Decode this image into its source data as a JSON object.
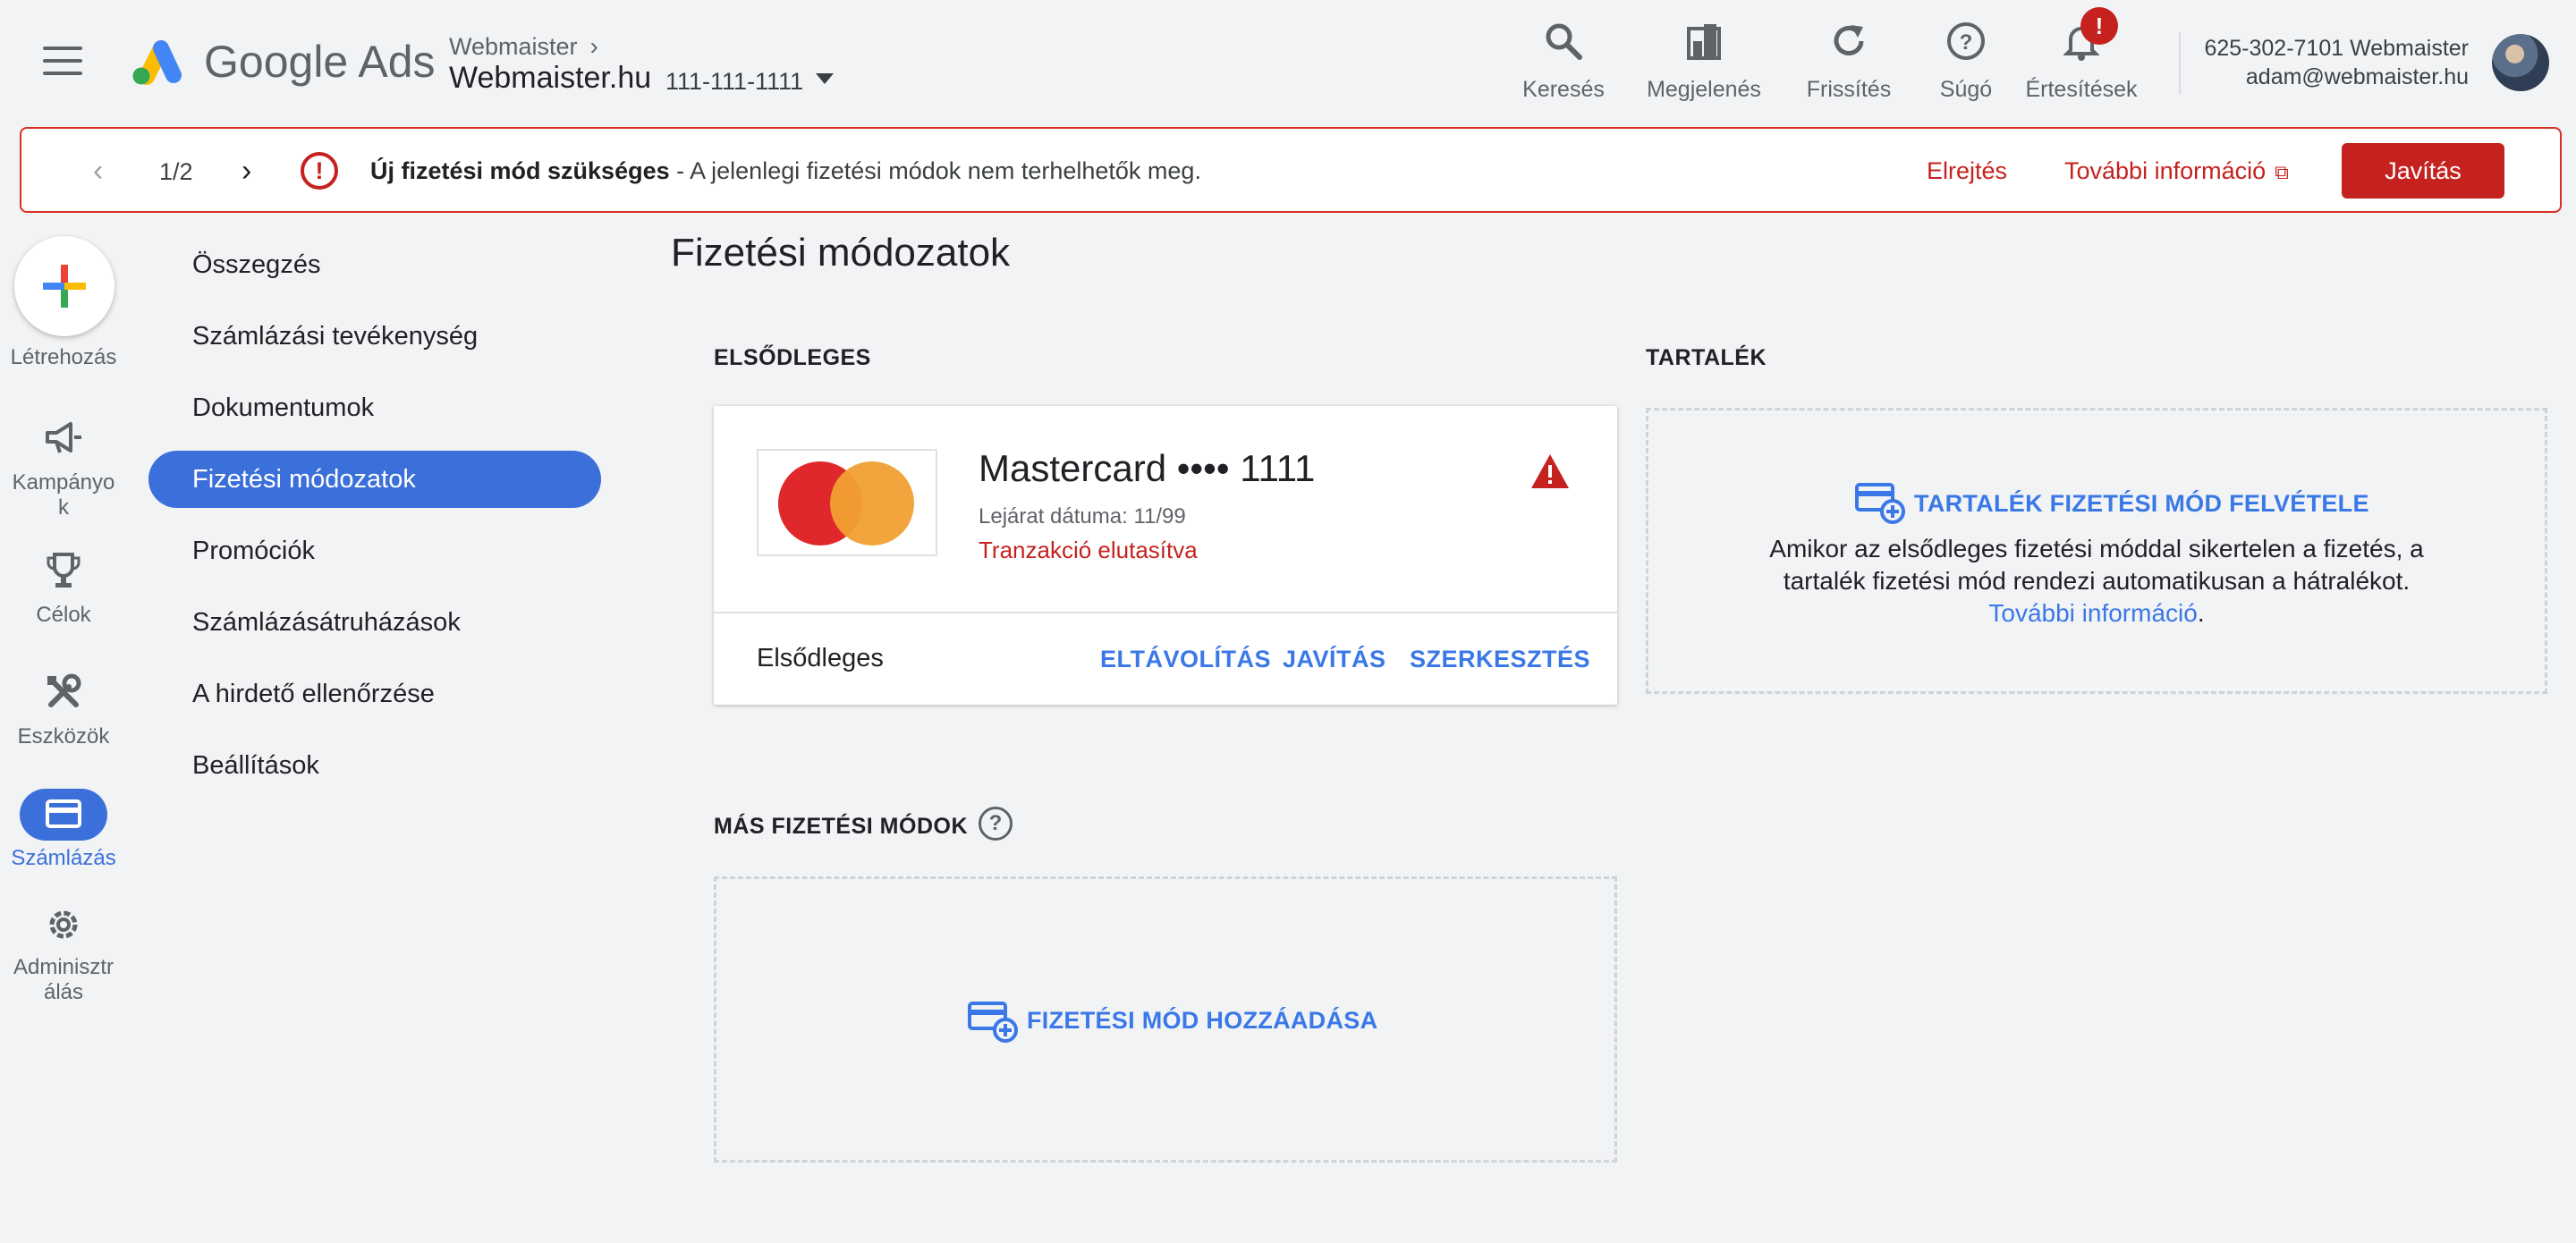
{
  "header": {
    "logo_text": "Google Ads",
    "account_parent": "Webmaister",
    "account_name": "Webmaister.hu",
    "account_id": "111-111-1111",
    "tools": [
      {
        "label": "Keresés",
        "icon": "search-icon"
      },
      {
        "label": "Megjelenés",
        "icon": "appearance-icon"
      },
      {
        "label": "Frissítés",
        "icon": "refresh-icon"
      },
      {
        "label": "Súgó",
        "icon": "help-icon"
      },
      {
        "label": "Értesítések",
        "icon": "bell-icon"
      }
    ],
    "notification_badge": "!",
    "user_phone": "625-302-7101 Webmaister",
    "user_email": "adam@webmaister.hu"
  },
  "banner": {
    "counter": "1/2",
    "title": "Új fizetési mód szükséges",
    "message": " - A jelenlegi fizetési módok nem terhelhetők meg.",
    "dismiss": "Elrejtés",
    "more": "További információ",
    "fix": "Javítás",
    "color": "#c5221f"
  },
  "rail": {
    "create": "Létrehozás",
    "items": [
      {
        "label": "Kampányo\nk",
        "icon": "megaphone-icon"
      },
      {
        "label": "Célok",
        "icon": "trophy-icon"
      },
      {
        "label": "Eszközök",
        "icon": "tools-icon"
      },
      {
        "label": "Számlázás",
        "icon": "credit-card-icon",
        "active": true
      },
      {
        "label": "Adminisztr\nálás",
        "icon": "gear-icon"
      }
    ]
  },
  "nav": {
    "items": [
      "Összegzés",
      "Számlázási tevékenység",
      "Dokumentumok",
      "Fizetési módozatok",
      "Promóciók",
      "Számlázásátruházások",
      "A hirdető ellenőrzése",
      "Beállítások"
    ],
    "active_index": 3
  },
  "main": {
    "title": "Fizetési módozatok",
    "primary_label": "ELSŐDLEGES",
    "backup_label": "TARTALÉK",
    "other_label": "MÁS FIZETÉSI MÓDOK",
    "card": {
      "title": "Mastercard •••• 1111",
      "expiry": "Lejárat dátuma: 11/99",
      "status": "Tranzakció elutasítva",
      "role": "Elsődleges",
      "actions": [
        "ELTÁVOLÍTÁS",
        "JAVÍTÁS",
        "SZERKESZTÉS"
      ]
    },
    "backup": {
      "add_label": "TARTALÉK FIZETÉSI MÓD FELVÉTELE",
      "desc_line1": "Amikor az elsődleges fizetési móddal sikertelen a fizetés, a",
      "desc_line2": "tartalék fizetési mód rendezi automatikusan a hátralékot.",
      "desc_link": "További információ",
      "desc_end": "."
    },
    "other": {
      "add_label": "FIZETÉSI MÓD HOZZÁADÁSA"
    },
    "accent_color": "#3b78e7"
  }
}
